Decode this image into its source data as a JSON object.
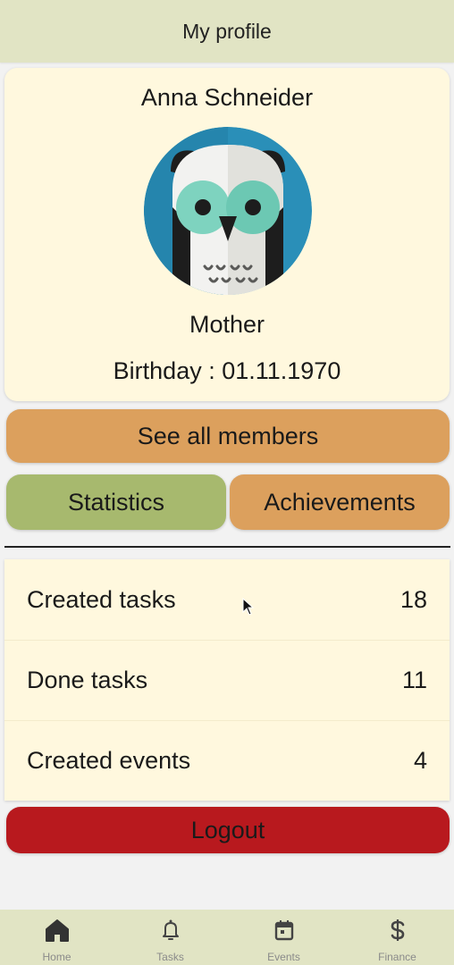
{
  "header": {
    "title": "My profile"
  },
  "profile": {
    "name": "Anna Schneider",
    "role": "Mother",
    "birthday": "Birthday : 01.11.1970"
  },
  "actions": {
    "see_all_members": "See all members",
    "tab_statistics": "Statistics",
    "tab_achievements": "Achievements",
    "logout": "Logout"
  },
  "statistics": [
    {
      "label": "Created tasks",
      "value": "18"
    },
    {
      "label": "Done tasks",
      "value": "11"
    },
    {
      "label": "Created events",
      "value": "4"
    }
  ],
  "nav": [
    {
      "label": "Home",
      "icon": "home-icon"
    },
    {
      "label": "Tasks",
      "icon": "bell-icon"
    },
    {
      "label": "Events",
      "icon": "calendar-icon"
    },
    {
      "label": "Finance",
      "icon": "dollar-icon"
    }
  ],
  "colors": {
    "header_bg": "#e1e4c4",
    "card_bg": "#fff8de",
    "orange": "#dca05d",
    "green": "#a7b96e",
    "logout_red": "#b8191e"
  }
}
